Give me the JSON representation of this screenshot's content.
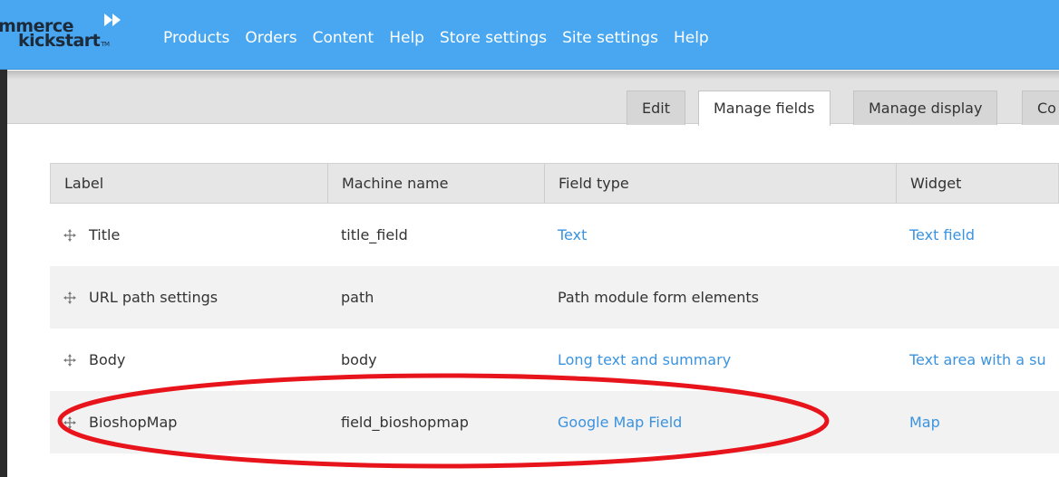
{
  "logo": {
    "line1": "mmerce",
    "line2": "kickstart",
    "tm": "TM",
    "accent_color": "#ffffff"
  },
  "nav": {
    "items": [
      "Products",
      "Orders",
      "Content",
      "Help",
      "Store settings",
      "Site settings",
      "Help"
    ]
  },
  "tabs": [
    {
      "label": "Edit",
      "active": false
    },
    {
      "label": "Manage fields",
      "active": true
    },
    {
      "label": "Manage display",
      "active": false
    },
    {
      "label": "Co",
      "active": false
    }
  ],
  "table": {
    "headers": [
      "Label",
      "Machine name",
      "Field type",
      "Widget"
    ],
    "rows": [
      {
        "label": "Title",
        "machine_name": "title_field",
        "field_type": "Text",
        "widget": "Text field"
      },
      {
        "label": "URL path settings",
        "machine_name": "path",
        "field_type": "Path module form elements",
        "widget": ""
      },
      {
        "label": "Body",
        "machine_name": "body",
        "field_type": "Long text and summary",
        "widget": "Text area with a su"
      },
      {
        "label": "BioshopMap",
        "machine_name": "field_bioshopmap",
        "field_type": "Google Map Field",
        "widget": "Map"
      }
    ]
  },
  "icons": {
    "drag": "move-handle-icon",
    "logo_arrows": "fast-forward-icon"
  },
  "colors": {
    "topbar": "#48a7f0",
    "link": "#3b93e0",
    "highlight": "#e8141c"
  }
}
